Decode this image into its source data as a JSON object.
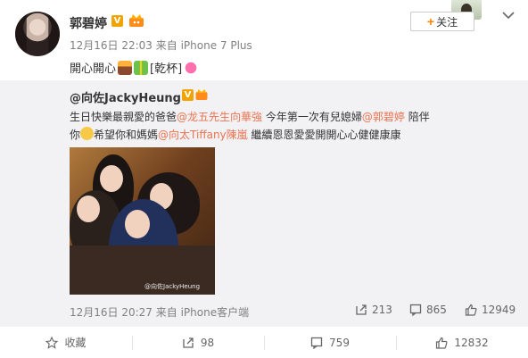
{
  "post": {
    "user_name": "郭碧婷",
    "verified_badge": "V",
    "meta": "12月16日 22:03 来自 iPhone 7 Plus",
    "follow_label": "关注",
    "content_text": "開心開心",
    "emoji_label": "[乾杯]"
  },
  "retweet": {
    "author": "@向佐JackyHeung",
    "verified_badge": "V",
    "text_1": "生日快樂最親愛的爸爸",
    "mention_1": "@龙五先生向華強",
    "text_2": " 今年第一次有兒媳婦",
    "mention_2": "@郭碧婷",
    "text_3": " 陪伴你",
    "text_4": "希望你和媽媽",
    "mention_3": "@向太Tiffany陳嵐",
    "text_5": " 繼續恩恩愛愛開開心心健健康康",
    "photo_watermark": "@向佐JackyHeung",
    "footer": "12月16日 20:27 来自 iPhone客户端",
    "reposts": "213",
    "comments": "865",
    "likes": "12949"
  },
  "actions": {
    "favorite": "收藏",
    "repost": "98",
    "comment": "759",
    "like": "12832"
  },
  "colors": {
    "link": "#eb7350",
    "accent": "#ff8200",
    "verified": "#f2a300",
    "retweet_bg": "#f2f2f5"
  }
}
